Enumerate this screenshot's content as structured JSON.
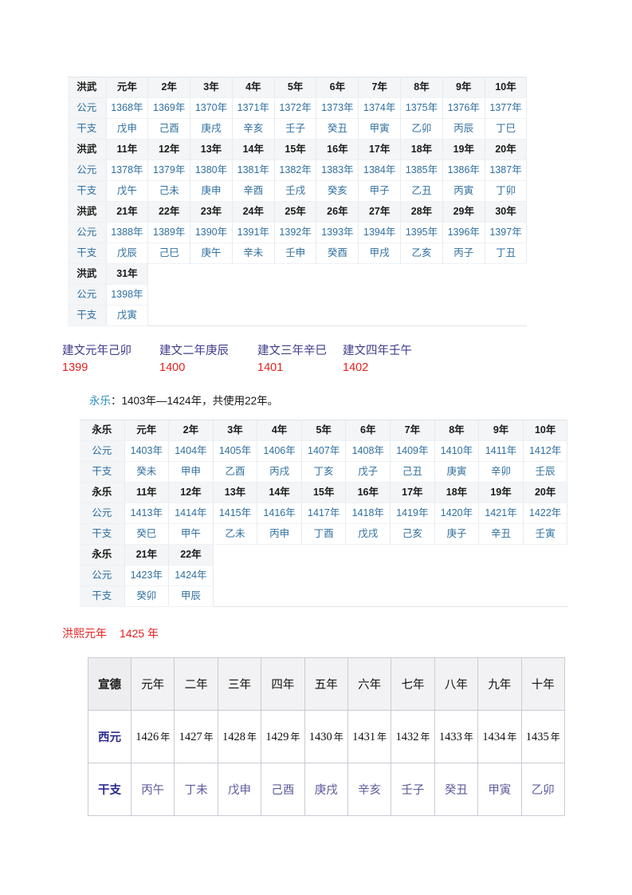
{
  "table_hongwu": {
    "label_era": "洪武",
    "label_ce": "公元",
    "label_gz": "干支",
    "blocks": [
      {
        "era": [
          "元年",
          "2年",
          "3年",
          "4年",
          "5年",
          "6年",
          "7年",
          "8年",
          "9年",
          "10年"
        ],
        "ce": [
          "1368年",
          "1369年",
          "1370年",
          "1371年",
          "1372年",
          "1373年",
          "1374年",
          "1375年",
          "1376年",
          "1377年"
        ],
        "gz": [
          "戊申",
          "己酉",
          "庚戌",
          "辛亥",
          "壬子",
          "癸丑",
          "甲寅",
          "乙卯",
          "丙辰",
          "丁巳"
        ]
      },
      {
        "era": [
          "11年",
          "12年",
          "13年",
          "14年",
          "15年",
          "16年",
          "17年",
          "18年",
          "19年",
          "20年"
        ],
        "ce": [
          "1378年",
          "1379年",
          "1380年",
          "1381年",
          "1382年",
          "1383年",
          "1384年",
          "1385年",
          "1386年",
          "1387年"
        ],
        "gz": [
          "戊午",
          "己未",
          "庚申",
          "辛酉",
          "壬戌",
          "癸亥",
          "甲子",
          "乙丑",
          "丙寅",
          "丁卯"
        ]
      },
      {
        "era": [
          "21年",
          "22年",
          "23年",
          "24年",
          "25年",
          "26年",
          "27年",
          "28年",
          "29年",
          "30年"
        ],
        "ce": [
          "1388年",
          "1389年",
          "1390年",
          "1391年",
          "1392年",
          "1393年",
          "1394年",
          "1395年",
          "1396年",
          "1397年"
        ],
        "gz": [
          "戊辰",
          "己巳",
          "庚午",
          "辛未",
          "壬申",
          "癸酉",
          "甲戌",
          "乙亥",
          "丙子",
          "丁丑"
        ]
      },
      {
        "era": [
          "31年"
        ],
        "ce": [
          "1398年"
        ],
        "gz": [
          "戊寅"
        ]
      }
    ]
  },
  "jianwen": {
    "items": [
      {
        "name": "建文元年己卯",
        "year": "1399"
      },
      {
        "name": "建文二年庚辰",
        "year": "1400"
      },
      {
        "name": "建文三年辛巳",
        "year": "1401"
      },
      {
        "name": "建文四年壬午",
        "year": "1402"
      }
    ]
  },
  "yongle_intro": {
    "era_name": "永乐",
    "text": "：1403年—1424年，共使用22年。"
  },
  "table_yongle": {
    "label_era": "永乐",
    "label_ce": "公元",
    "label_gz": "干支",
    "blocks": [
      {
        "era": [
          "元年",
          "2年",
          "3年",
          "4年",
          "5年",
          "6年",
          "7年",
          "8年",
          "9年",
          "10年"
        ],
        "ce": [
          "1403年",
          "1404年",
          "1405年",
          "1406年",
          "1407年",
          "1408年",
          "1409年",
          "1410年",
          "1411年",
          "1412年"
        ],
        "gz": [
          "癸未",
          "甲申",
          "乙酉",
          "丙戌",
          "丁亥",
          "戊子",
          "己丑",
          "庚寅",
          "辛卯",
          "壬辰"
        ]
      },
      {
        "era": [
          "11年",
          "12年",
          "13年",
          "14年",
          "15年",
          "16年",
          "17年",
          "18年",
          "19年",
          "20年"
        ],
        "ce": [
          "1413年",
          "1414年",
          "1415年",
          "1416年",
          "1417年",
          "1418年",
          "1419年",
          "1420年",
          "1421年",
          "1422年"
        ],
        "gz": [
          "癸巳",
          "甲午",
          "乙未",
          "丙申",
          "丁酉",
          "戊戌",
          "己亥",
          "庚子",
          "辛丑",
          "壬寅"
        ]
      },
      {
        "era": [
          "21年",
          "22年"
        ],
        "ce": [
          "1423年",
          "1424年"
        ],
        "gz": [
          "癸卯",
          "甲辰"
        ]
      }
    ]
  },
  "hongxi": {
    "name": "洪熙元年",
    "year": "1425 年"
  },
  "table_xuande": {
    "label_era": "宣德",
    "label_ce": "西元",
    "label_gz": "干支",
    "era": [
      "元年",
      "二年",
      "三年",
      "四年",
      "五年",
      "六年",
      "七年",
      "八年",
      "九年",
      "十年"
    ],
    "ce_num": [
      "1426",
      "1427",
      "1428",
      "1429",
      "1430",
      "1431",
      "1432",
      "1433",
      "1434",
      "1435"
    ],
    "ce_unit": "年",
    "gz": [
      "丙午",
      "丁未",
      "戊申",
      "己酉",
      "庚戌",
      "辛亥",
      "壬子",
      "癸丑",
      "甲寅",
      "乙卯"
    ]
  },
  "colors": {
    "era_blue": "#2f6f9f",
    "jianwen_name": "#3c3c8c",
    "red": "#e8201f",
    "xuande_purple": "#5b5b9c",
    "xuande_navy": "#2b2b8f",
    "teal": "#2f8fbf"
  }
}
